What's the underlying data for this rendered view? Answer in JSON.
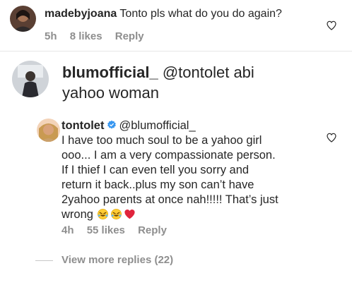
{
  "comments": [
    {
      "username": "madebyjoana",
      "text": "Tonto pls what do you do again?",
      "time": "5h",
      "likes": "8 likes",
      "reply": "Reply"
    },
    {
      "username": "blumofficial_",
      "mention": "@tontolet",
      "text_1": "abi",
      "text_2": "yahoo woman"
    },
    {
      "username": "tontolet",
      "mention": "@blumofficial_",
      "lines": [
        "I have too much soul to be a yahoo girl",
        "ooo... I am a very compassionate person.",
        "If I thief I can even tell you sorry and",
        "return it back..plus my son can’t have",
        "2yahoo parents at once nah!!!!! That’s just"
      ],
      "last_line": "wrong",
      "emojis": [
        "rofl-emoji",
        "rofl-emoji",
        "red-heart-emoji"
      ],
      "time": "4h",
      "likes": "55 likes",
      "reply": "Reply"
    }
  ],
  "view_more": "View more replies (22)",
  "colors": {
    "text": "#262626",
    "muted": "#8e8e8e",
    "verified": "#3897f0",
    "heart": "#e0245e"
  },
  "icons": {
    "like": "heart-outline-icon",
    "verified": "verified-badge-icon"
  }
}
